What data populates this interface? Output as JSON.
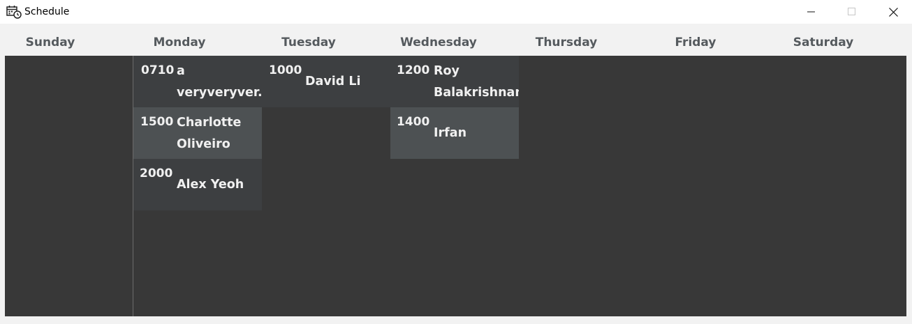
{
  "window": {
    "title": "Schedule",
    "icon": "calendar-clock-icon",
    "controls": [
      "minimize-icon",
      "maximize-icon",
      "close-icon"
    ]
  },
  "days": [
    "Sunday",
    "Monday",
    "Tuesday",
    "Wednesday",
    "Thursday",
    "Friday",
    "Saturday"
  ],
  "slots": {
    "monday": [
      {
        "time": "0710",
        "name": "a\nveryveryver..."
      },
      {
        "time": "1500",
        "name": "Charlotte\nOliveiro"
      },
      {
        "time": "2000",
        "name": "Alex Yeoh"
      }
    ],
    "tuesday": [
      {
        "time": "1000",
        "name": "David Li"
      }
    ],
    "wednesday": [
      {
        "time": "1200",
        "name": "Roy\nBalakrishnan"
      },
      {
        "time": "1400",
        "name": "Irfan Ibrahim"
      }
    ]
  },
  "colors": {
    "grid_background": "#383838",
    "slot_dark": "#3d3f41",
    "slot_light": "#4d5153",
    "header_text": "#555a5e"
  }
}
